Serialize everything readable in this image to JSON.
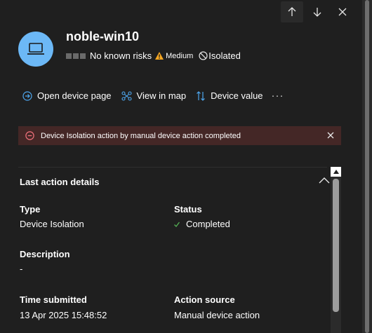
{
  "nav": {
    "up_icon": "arrow-up-icon",
    "down_icon": "arrow-down-icon",
    "close_icon": "close-icon"
  },
  "device": {
    "name": "noble-win10",
    "risk_text": "No known risks",
    "severity": "Medium",
    "isolation": "Isolated",
    "icon": "laptop-icon"
  },
  "actions": [
    {
      "label": "Open device page",
      "icon": "open-device-icon"
    },
    {
      "label": "View in map",
      "icon": "map-icon"
    },
    {
      "label": "Device value",
      "icon": "sort-value-icon"
    }
  ],
  "more_label": "···",
  "banner": {
    "text": "Device Isolation action by manual device action completed"
  },
  "details": {
    "title": "Last action details",
    "type_label": "Type",
    "type_value": "Device Isolation",
    "status_label": "Status",
    "status_value": "Completed",
    "description_label": "Description",
    "description_value": "-",
    "time_label": "Time submitted",
    "time_value": "13 Apr 2025 15:48:52",
    "source_label": "Action source",
    "source_value": "Manual device action"
  },
  "colors": {
    "background": "#1f1f1f",
    "avatar": "#6cb8f6",
    "accent": "#4ea8f0",
    "banner_bg": "#442726",
    "error": "#f1707b",
    "warning": "#f7a823",
    "success": "#54b054"
  }
}
